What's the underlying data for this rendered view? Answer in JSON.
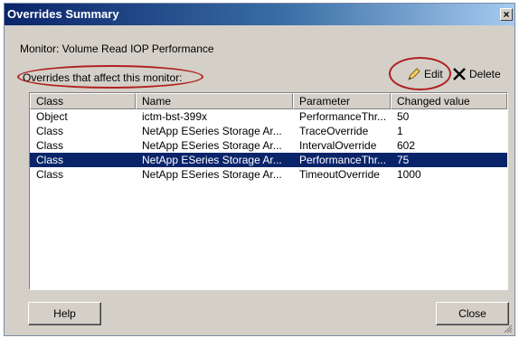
{
  "dialog": {
    "title": "Overrides Summary",
    "close_glyph": "×",
    "monitor_text": "Monitor: Volume Read IOP Performance",
    "overrides_label": "Overrides that affect this monitor:",
    "edit_label": "Edit",
    "delete_label": "Delete",
    "help_label": "Help",
    "close_label": "Close"
  },
  "table": {
    "columns": [
      "Class",
      "Name",
      "Parameter",
      "Changed value"
    ],
    "rows": [
      {
        "class": "Object",
        "name": "ictm-bst-399x",
        "parameter": "PerformanceThr...",
        "value": "50"
      },
      {
        "class": "Class",
        "name": "NetApp ESeries Storage Ar...",
        "parameter": "TraceOverride",
        "value": "1"
      },
      {
        "class": "Class",
        "name": "NetApp ESeries Storage Ar...",
        "parameter": "IntervalOverride",
        "value": "602"
      },
      {
        "class": "Class",
        "name": "NetApp ESeries Storage Ar...",
        "parameter": "PerformanceThr...",
        "value": "75"
      },
      {
        "class": "Class",
        "name": "NetApp ESeries Storage Ar...",
        "parameter": "TimeoutOverride",
        "value": "1000"
      }
    ],
    "selected_row": 3
  },
  "colors": {
    "selection": "#0a246a",
    "highlight_ellipse": "#b02020"
  }
}
